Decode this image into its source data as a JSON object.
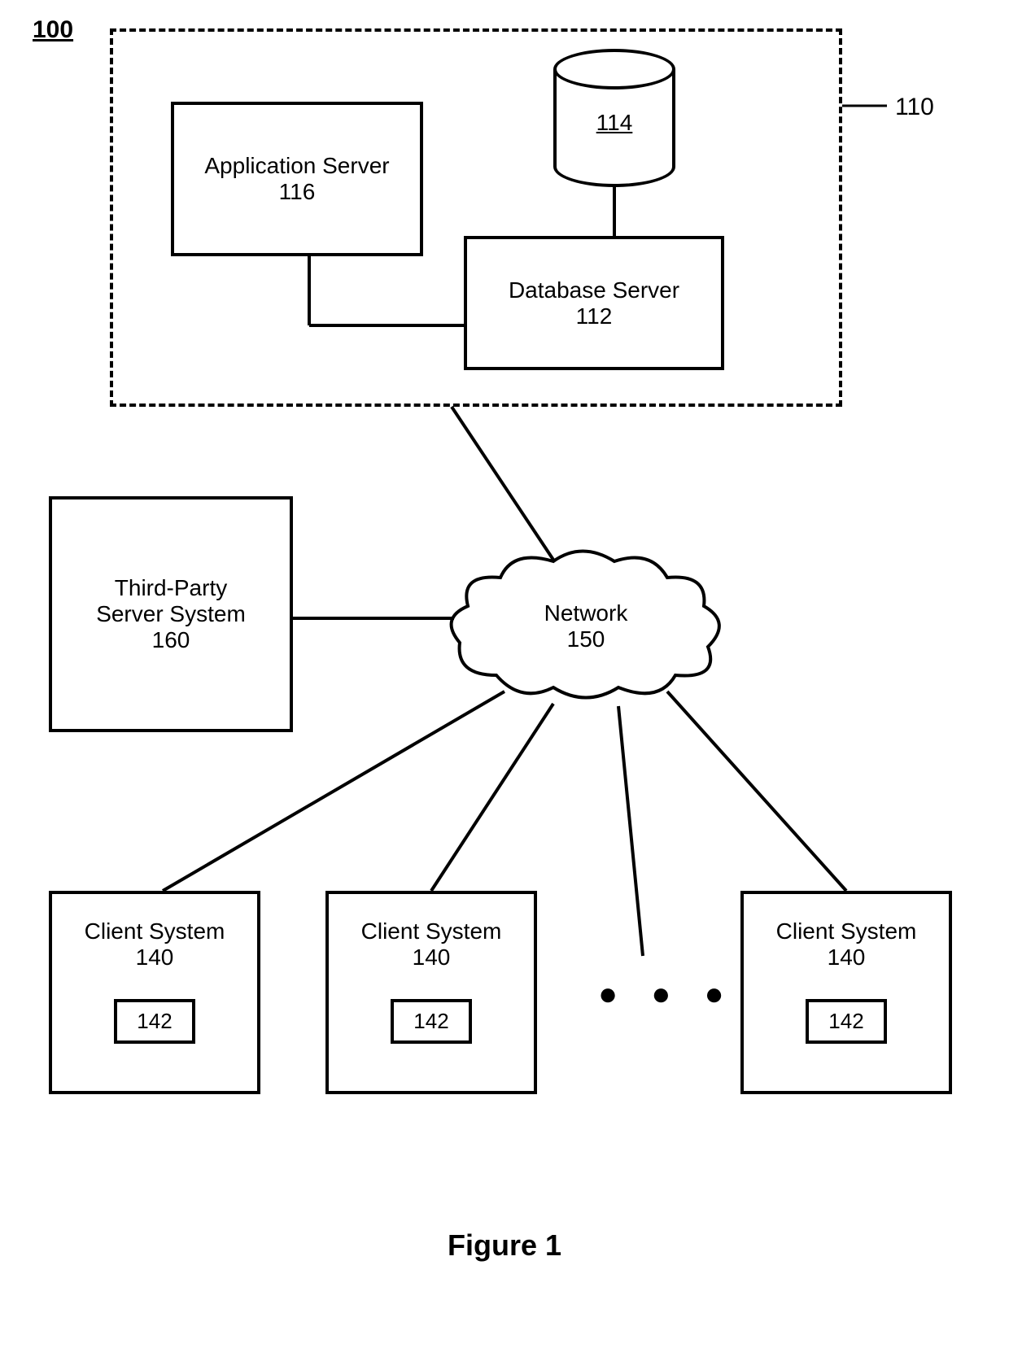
{
  "diagram": {
    "system_label": "100",
    "server_group_label": "110",
    "app_server": {
      "title": "Application Server",
      "num": "116"
    },
    "db_server": {
      "title": "Database Server",
      "num": "112"
    },
    "datastore": {
      "num": "114"
    },
    "third_party": {
      "line1": "Third-Party",
      "line2": "Server System",
      "num": "160"
    },
    "network": {
      "title": "Network",
      "num": "150"
    },
    "clients": [
      {
        "title": "Client System",
        "num": "140",
        "inner": "142"
      },
      {
        "title": "Client System",
        "num": "140",
        "inner": "142"
      },
      {
        "title": "Client System",
        "num": "140",
        "inner": "142"
      }
    ],
    "ellipsis": "● ● ●",
    "caption": "Figure 1"
  }
}
